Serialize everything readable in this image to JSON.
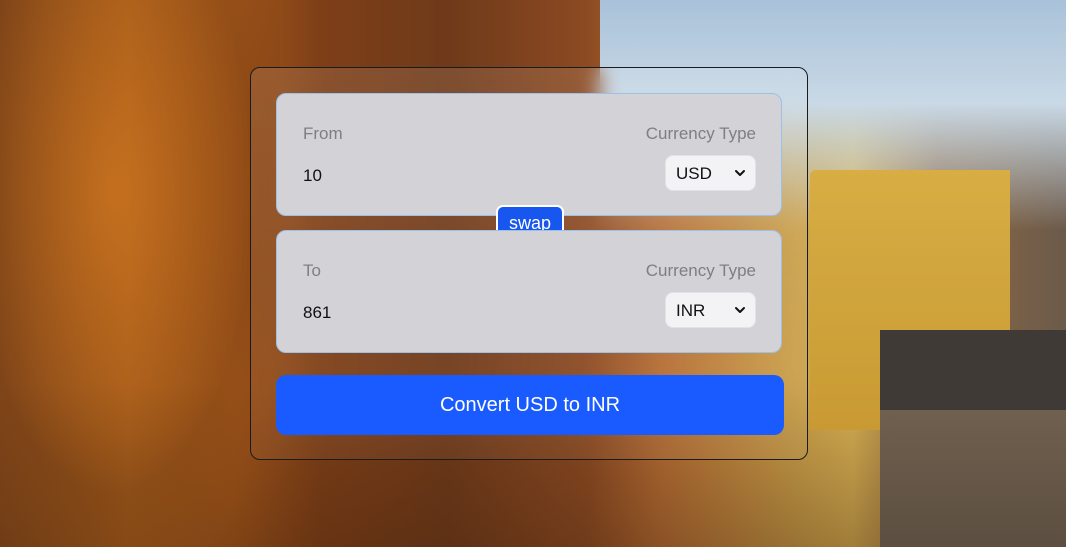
{
  "converter": {
    "from": {
      "label": "From",
      "currency_type_label": "Currency Type",
      "amount": "10",
      "currency": "USD"
    },
    "to": {
      "label": "To",
      "currency_type_label": "Currency Type",
      "amount": "861",
      "currency": "INR"
    },
    "swap_label": "swap",
    "convert_label": "Convert USD to INR"
  },
  "icons": {
    "select_arrow": "chevron-down-icon"
  },
  "colors": {
    "primary_button": "#1a5bff",
    "swap_button": "#1757f0",
    "panel_bg": "#d3d2d7",
    "panel_border": "#9bc0ea"
  }
}
